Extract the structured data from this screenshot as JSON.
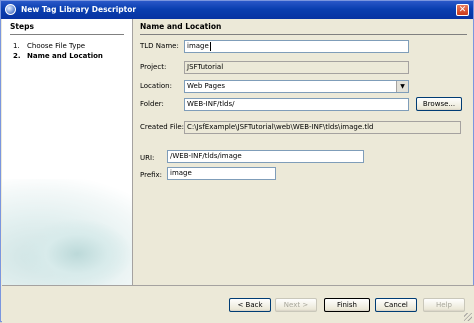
{
  "window": {
    "title": "New Tag Library Descriptor",
    "close_glyph": "✕"
  },
  "steps": {
    "heading": "Steps",
    "items": [
      {
        "number": "1.",
        "label": "Choose File Type"
      },
      {
        "number": "2.",
        "label": "Name and Location"
      }
    ]
  },
  "panel": {
    "heading": "Name and Location",
    "tld_name": {
      "label": "TLD Name:",
      "value": "image"
    },
    "project": {
      "label": "Project:",
      "value": "JSFTutorial"
    },
    "location": {
      "label": "Location:",
      "value": "Web Pages"
    },
    "folder": {
      "label": "Folder:",
      "value": "WEB-INF/tlds/"
    },
    "browse_label": "Browse...",
    "created_file": {
      "label": "Created File:",
      "value": "C:\\JsfExample\\JSFTutorial\\web\\WEB-INF\\tlds\\image.tld"
    },
    "uri": {
      "label": "URI:",
      "value": "/WEB-INF/tlds/image"
    },
    "prefix": {
      "label": "Prefix:",
      "value": "image"
    }
  },
  "buttons": {
    "back": "< Back",
    "next": "Next >",
    "finish": "Finish",
    "cancel": "Cancel",
    "help": "Help"
  },
  "icons": {
    "dropdown": "chevron-down-icon",
    "window": "netbeans-icon"
  }
}
